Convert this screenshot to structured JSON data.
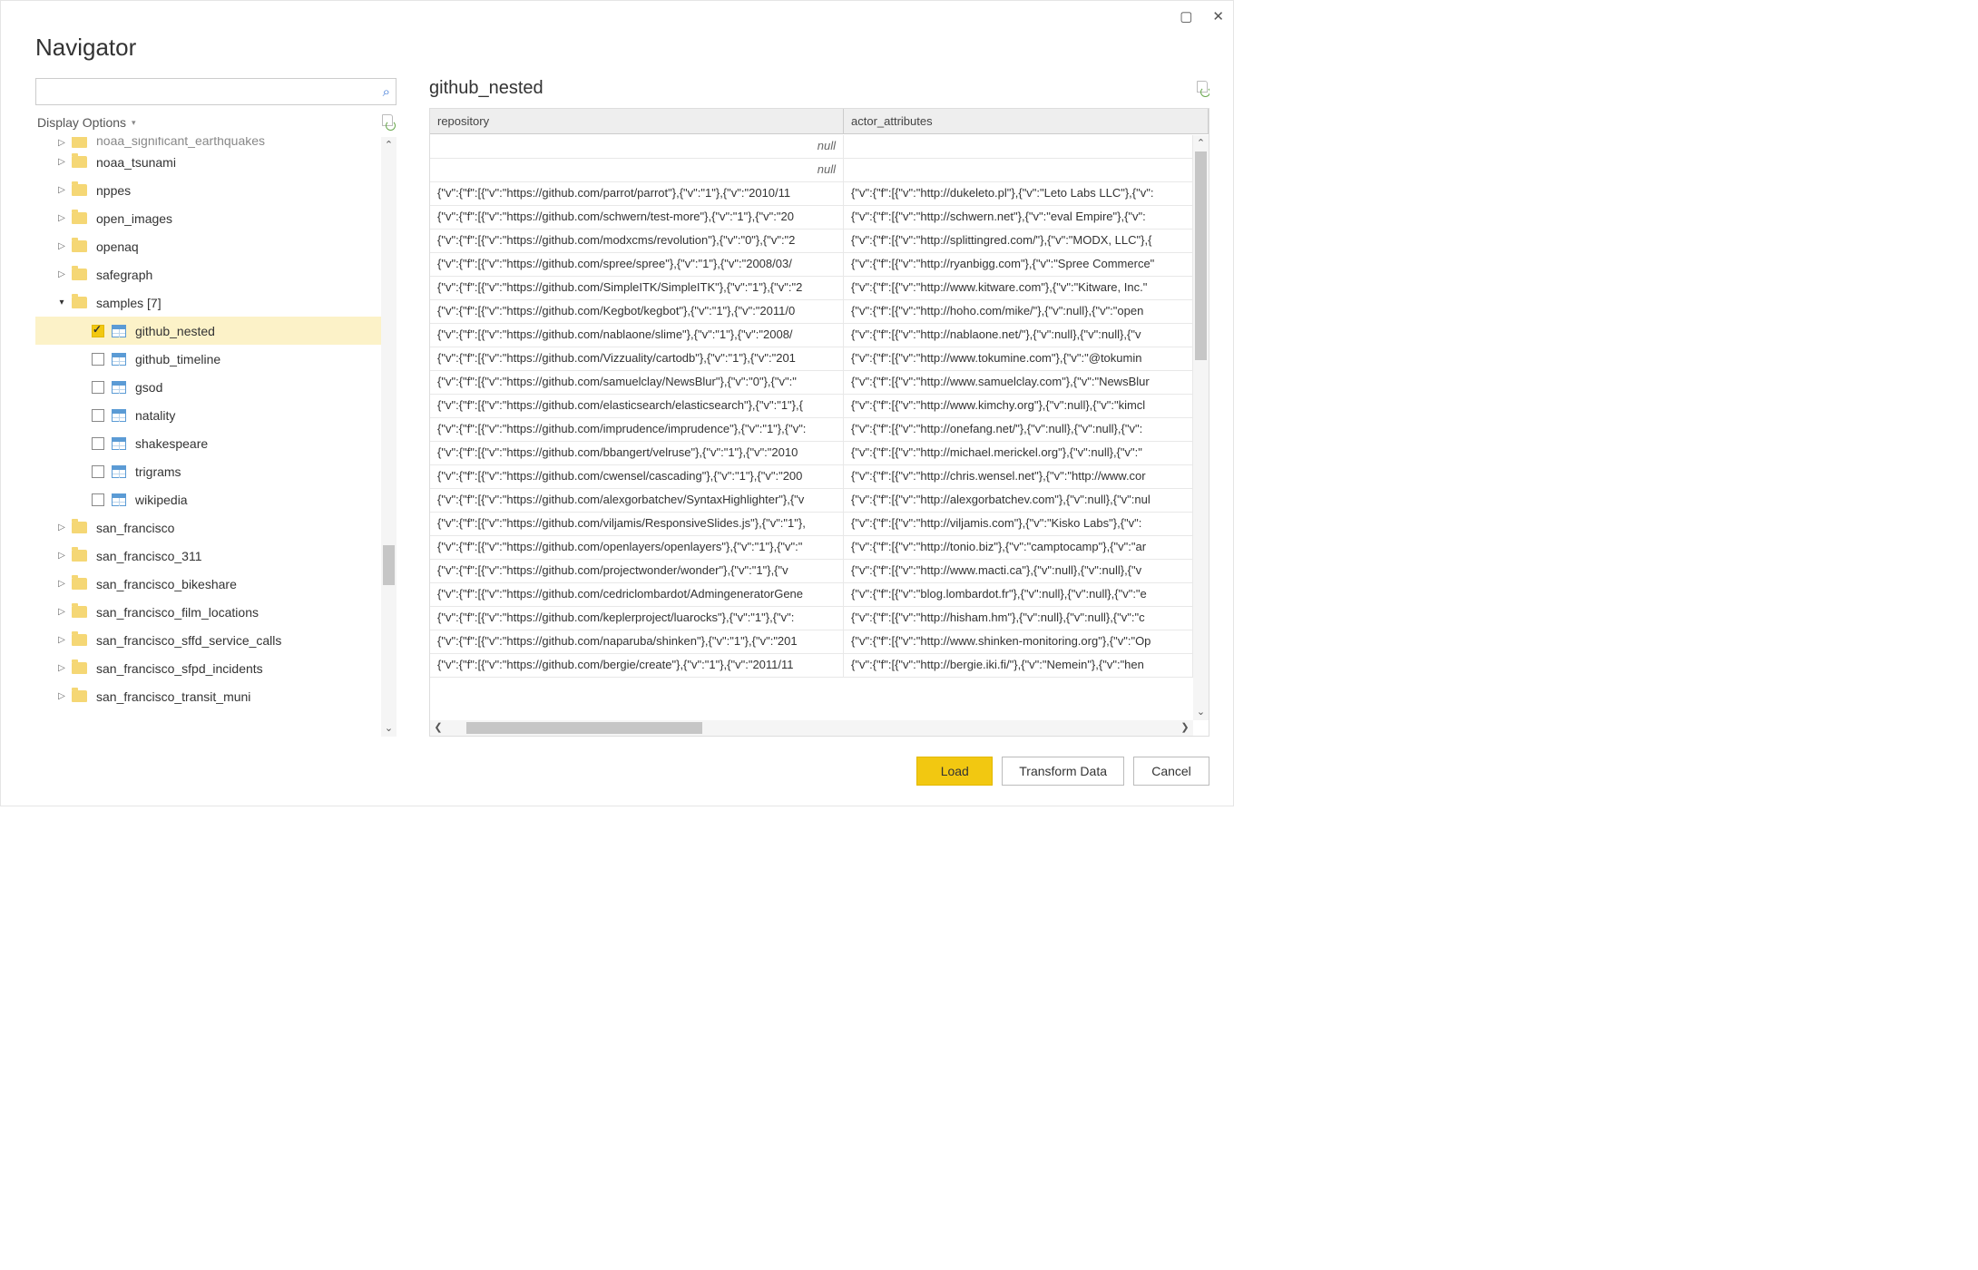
{
  "window": {
    "title": "Navigator"
  },
  "sidebar": {
    "search_placeholder": "",
    "display_options": "Display Options",
    "items": [
      {
        "label": "noaa_significant_earthquakes",
        "type": "folder",
        "indent": 1,
        "expandable": true,
        "partial": true
      },
      {
        "label": "noaa_tsunami",
        "type": "folder",
        "indent": 1,
        "expandable": true
      },
      {
        "label": "nppes",
        "type": "folder",
        "indent": 1,
        "expandable": true
      },
      {
        "label": "open_images",
        "type": "folder",
        "indent": 1,
        "expandable": true
      },
      {
        "label": "openaq",
        "type": "folder",
        "indent": 1,
        "expandable": true
      },
      {
        "label": "safegraph",
        "type": "folder",
        "indent": 1,
        "expandable": true
      },
      {
        "label": "samples [7]",
        "type": "folder",
        "indent": 1,
        "expandable": true,
        "expanded": true
      },
      {
        "label": "github_nested",
        "type": "table",
        "indent": 2,
        "checked": true,
        "selected": true
      },
      {
        "label": "github_timeline",
        "type": "table",
        "indent": 2
      },
      {
        "label": "gsod",
        "type": "table",
        "indent": 2
      },
      {
        "label": "natality",
        "type": "table",
        "indent": 2
      },
      {
        "label": "shakespeare",
        "type": "table",
        "indent": 2
      },
      {
        "label": "trigrams",
        "type": "table",
        "indent": 2
      },
      {
        "label": "wikipedia",
        "type": "table",
        "indent": 2
      },
      {
        "label": "san_francisco",
        "type": "folder",
        "indent": 1,
        "expandable": true
      },
      {
        "label": "san_francisco_311",
        "type": "folder",
        "indent": 1,
        "expandable": true
      },
      {
        "label": "san_francisco_bikeshare",
        "type": "folder",
        "indent": 1,
        "expandable": true
      },
      {
        "label": "san_francisco_film_locations",
        "type": "folder",
        "indent": 1,
        "expandable": true
      },
      {
        "label": "san_francisco_sffd_service_calls",
        "type": "folder",
        "indent": 1,
        "expandable": true
      },
      {
        "label": "san_francisco_sfpd_incidents",
        "type": "folder",
        "indent": 1,
        "expandable": true
      },
      {
        "label": "san_francisco_transit_muni",
        "type": "folder",
        "indent": 1,
        "expandable": true,
        "partial_bottom": true
      }
    ]
  },
  "preview": {
    "title": "github_nested",
    "columns": [
      {
        "key": "repository",
        "label": "repository"
      },
      {
        "key": "actor_attributes",
        "label": "actor_attributes"
      }
    ],
    "rows": [
      {
        "repository": "null",
        "actor_attributes": "",
        "null0": true
      },
      {
        "repository": "null",
        "actor_attributes": "",
        "null0": true
      },
      {
        "repository": "{\"v\":{\"f\":[{\"v\":\"https://github.com/parrot/parrot\"},{\"v\":\"1\"},{\"v\":\"2010/11",
        "actor_attributes": "{\"v\":{\"f\":[{\"v\":\"http://dukeleto.pl\"},{\"v\":\"Leto Labs LLC\"},{\"v\":"
      },
      {
        "repository": "{\"v\":{\"f\":[{\"v\":\"https://github.com/schwern/test-more\"},{\"v\":\"1\"},{\"v\":\"20",
        "actor_attributes": "{\"v\":{\"f\":[{\"v\":\"http://schwern.net\"},{\"v\":\"eval Empire\"},{\"v\":"
      },
      {
        "repository": "{\"v\":{\"f\":[{\"v\":\"https://github.com/modxcms/revolution\"},{\"v\":\"0\"},{\"v\":\"2",
        "actor_attributes": "{\"v\":{\"f\":[{\"v\":\"http://splittingred.com/\"},{\"v\":\"MODX, LLC\"},{"
      },
      {
        "repository": "{\"v\":{\"f\":[{\"v\":\"https://github.com/spree/spree\"},{\"v\":\"1\"},{\"v\":\"2008/03/",
        "actor_attributes": "{\"v\":{\"f\":[{\"v\":\"http://ryanbigg.com\"},{\"v\":\"Spree Commerce\""
      },
      {
        "repository": "{\"v\":{\"f\":[{\"v\":\"https://github.com/SimpleITK/SimpleITK\"},{\"v\":\"1\"},{\"v\":\"2",
        "actor_attributes": "{\"v\":{\"f\":[{\"v\":\"http://www.kitware.com\"},{\"v\":\"Kitware, Inc.\""
      },
      {
        "repository": "{\"v\":{\"f\":[{\"v\":\"https://github.com/Kegbot/kegbot\"},{\"v\":\"1\"},{\"v\":\"2011/0",
        "actor_attributes": "{\"v\":{\"f\":[{\"v\":\"http://hoho.com/mike/\"},{\"v\":null},{\"v\":\"open"
      },
      {
        "repository": "{\"v\":{\"f\":[{\"v\":\"https://github.com/nablaone/slime\"},{\"v\":\"1\"},{\"v\":\"2008/",
        "actor_attributes": "{\"v\":{\"f\":[{\"v\":\"http://nablaone.net/\"},{\"v\":null},{\"v\":null},{\"v"
      },
      {
        "repository": "{\"v\":{\"f\":[{\"v\":\"https://github.com/Vizzuality/cartodb\"},{\"v\":\"1\"},{\"v\":\"201",
        "actor_attributes": "{\"v\":{\"f\":[{\"v\":\"http://www.tokumine.com\"},{\"v\":\"@tokumin"
      },
      {
        "repository": "{\"v\":{\"f\":[{\"v\":\"https://github.com/samuelclay/NewsBlur\"},{\"v\":\"0\"},{\"v\":\"",
        "actor_attributes": "{\"v\":{\"f\":[{\"v\":\"http://www.samuelclay.com\"},{\"v\":\"NewsBlur"
      },
      {
        "repository": "{\"v\":{\"f\":[{\"v\":\"https://github.com/elasticsearch/elasticsearch\"},{\"v\":\"1\"},{",
        "actor_attributes": "{\"v\":{\"f\":[{\"v\":\"http://www.kimchy.org\"},{\"v\":null},{\"v\":\"kimcl"
      },
      {
        "repository": "{\"v\":{\"f\":[{\"v\":\"https://github.com/imprudence/imprudence\"},{\"v\":\"1\"},{\"v\":",
        "actor_attributes": "{\"v\":{\"f\":[{\"v\":\"http://onefang.net/\"},{\"v\":null},{\"v\":null},{\"v\":"
      },
      {
        "repository": "{\"v\":{\"f\":[{\"v\":\"https://github.com/bbangert/velruse\"},{\"v\":\"1\"},{\"v\":\"2010",
        "actor_attributes": "{\"v\":{\"f\":[{\"v\":\"http://michael.merickel.org\"},{\"v\":null},{\"v\":\""
      },
      {
        "repository": "{\"v\":{\"f\":[{\"v\":\"https://github.com/cwensel/cascading\"},{\"v\":\"1\"},{\"v\":\"200",
        "actor_attributes": "{\"v\":{\"f\":[{\"v\":\"http://chris.wensel.net\"},{\"v\":\"http://www.cor"
      },
      {
        "repository": "{\"v\":{\"f\":[{\"v\":\"https://github.com/alexgorbatchev/SyntaxHighlighter\"},{\"v",
        "actor_attributes": "{\"v\":{\"f\":[{\"v\":\"http://alexgorbatchev.com\"},{\"v\":null},{\"v\":nul"
      },
      {
        "repository": "{\"v\":{\"f\":[{\"v\":\"https://github.com/viljamis/ResponsiveSlides.js\"},{\"v\":\"1\"},",
        "actor_attributes": "{\"v\":{\"f\":[{\"v\":\"http://viljamis.com\"},{\"v\":\"Kisko Labs\"},{\"v\":"
      },
      {
        "repository": "{\"v\":{\"f\":[{\"v\":\"https://github.com/openlayers/openlayers\"},{\"v\":\"1\"},{\"v\":\"",
        "actor_attributes": "{\"v\":{\"f\":[{\"v\":\"http://tonio.biz\"},{\"v\":\"camptocamp\"},{\"v\":\"ar"
      },
      {
        "repository": "{\"v\":{\"f\":[{\"v\":\"https://github.com/projectwonder/wonder\"},{\"v\":\"1\"},{\"v",
        "actor_attributes": "{\"v\":{\"f\":[{\"v\":\"http://www.macti.ca\"},{\"v\":null},{\"v\":null},{\"v"
      },
      {
        "repository": "{\"v\":{\"f\":[{\"v\":\"https://github.com/cedriclombardot/AdmingeneratorGene",
        "actor_attributes": "{\"v\":{\"f\":[{\"v\":\"blog.lombardot.fr\"},{\"v\":null},{\"v\":null},{\"v\":\"e"
      },
      {
        "repository": "{\"v\":{\"f\":[{\"v\":\"https://github.com/keplerproject/luarocks\"},{\"v\":\"1\"},{\"v\":",
        "actor_attributes": "{\"v\":{\"f\":[{\"v\":\"http://hisham.hm\"},{\"v\":null},{\"v\":null},{\"v\":\"c"
      },
      {
        "repository": "{\"v\":{\"f\":[{\"v\":\"https://github.com/naparuba/shinken\"},{\"v\":\"1\"},{\"v\":\"201",
        "actor_attributes": "{\"v\":{\"f\":[{\"v\":\"http://www.shinken-monitoring.org\"},{\"v\":\"Op"
      },
      {
        "repository": "{\"v\":{\"f\":[{\"v\":\"https://github.com/bergie/create\"},{\"v\":\"1\"},{\"v\":\"2011/11",
        "actor_attributes": "{\"v\":{\"f\":[{\"v\":\"http://bergie.iki.fi/\"},{\"v\":\"Nemein\"},{\"v\":\"hen"
      }
    ]
  },
  "footer": {
    "load": "Load",
    "transform": "Transform Data",
    "cancel": "Cancel"
  }
}
